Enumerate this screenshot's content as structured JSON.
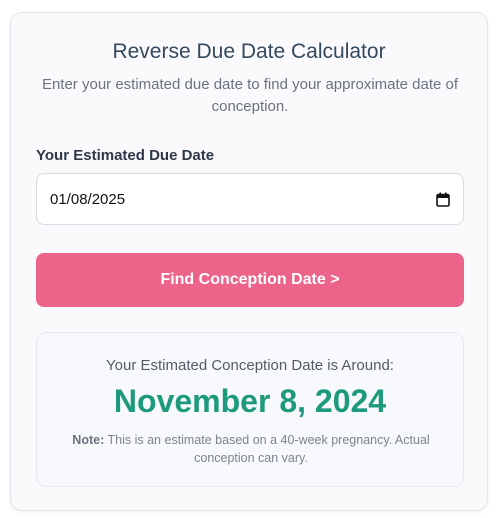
{
  "app": {
    "title": "Reverse Due Date Calculator",
    "subtitle": "Enter your estimated due date to find your approximate date of conception."
  },
  "form": {
    "due_date_label": "Your Estimated Due Date",
    "due_date_value": "01/08/2025",
    "calendar_icon": "calendar-icon",
    "submit_label": "Find Conception Date >"
  },
  "result": {
    "heading": "Your Estimated Conception Date is Around:",
    "date": "November 8, 2024",
    "note_label": "Note:",
    "note_text": "This is an estimate based on a 40-week pregnancy. Actual conception can vary."
  },
  "colors": {
    "button": "#ec648a",
    "result_date": "#1d9a7c",
    "title": "#34495e"
  }
}
